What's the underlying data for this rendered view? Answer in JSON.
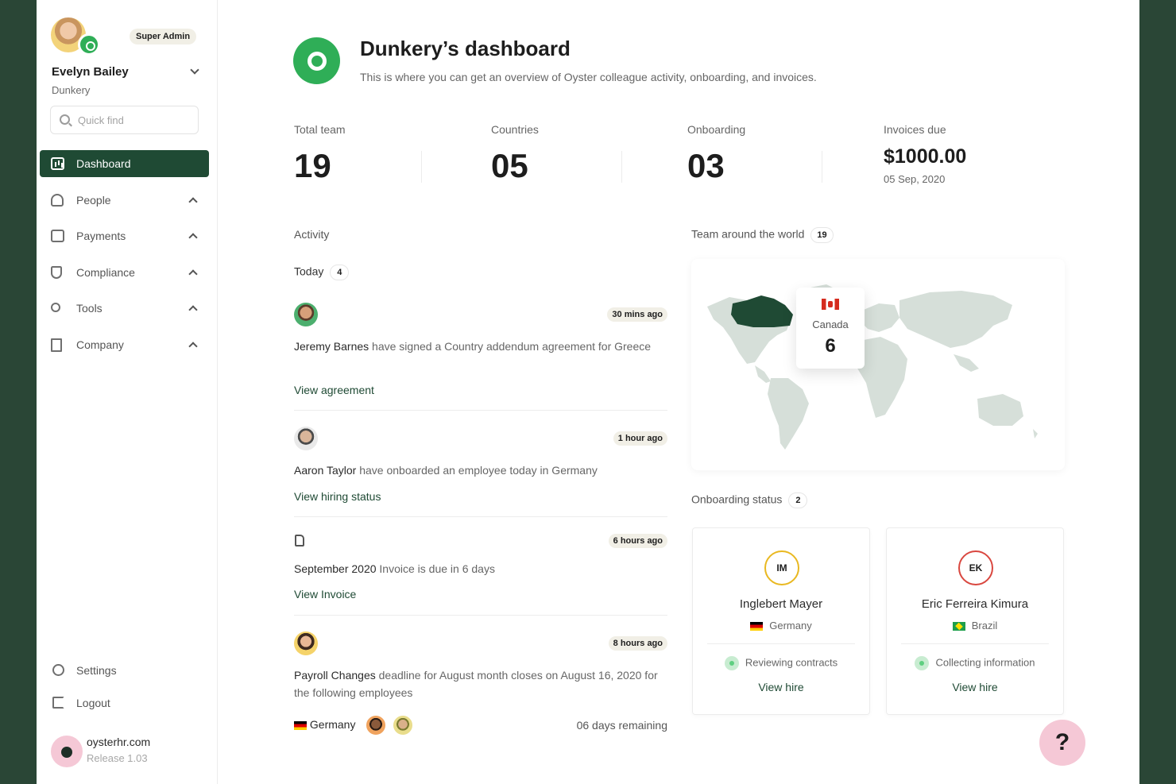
{
  "sidebar": {
    "user": {
      "name": "Evelyn Bailey",
      "company": "Dunkery",
      "role": "Super Admin"
    },
    "search": {
      "placeholder": "Quick find"
    },
    "nav": [
      {
        "label": "Dashboard",
        "icon": "chart-icon",
        "active": true
      },
      {
        "label": "People",
        "icon": "people-icon"
      },
      {
        "label": "Payments",
        "icon": "wallet-icon"
      },
      {
        "label": "Compliance",
        "icon": "shield-icon"
      },
      {
        "label": "Tools",
        "icon": "wrench-icon"
      },
      {
        "label": "Company",
        "icon": "building-icon"
      }
    ],
    "bottom": {
      "settings": "Settings",
      "logout": "Logout"
    },
    "brand": {
      "url": "oysterhr.com",
      "release": "Release 1.03"
    }
  },
  "header": {
    "title": "Dunkery’s dashboard",
    "subtitle": "This is where you can get an overview of Oyster colleague activity, onboarding, and invoices."
  },
  "stats": {
    "total_team": {
      "label": "Total team",
      "value": "19"
    },
    "countries": {
      "label": "Countries",
      "value": "05"
    },
    "onboarding": {
      "label": "Onboarding",
      "value": "03"
    },
    "invoices": {
      "label": "Invoices due",
      "value": "$1000.00",
      "date": "05 Sep, 2020"
    }
  },
  "activity": {
    "title": "Activity",
    "today_label": "Today",
    "today_count": "4",
    "items": [
      {
        "time": "30 mins ago",
        "actor": "Jeremy Barnes",
        "text": " have signed a Country addendum agreement for Greece",
        "link": "View agreement"
      },
      {
        "time": "1 hour ago",
        "actor": "Aaron Taylor",
        "text": " have onboarded an employee today in Germany",
        "link": "View hiring status"
      },
      {
        "time": "6 hours ago",
        "actor": "September 2020",
        "text": " Invoice is due in 6 days",
        "link": "View Invoice"
      },
      {
        "time": "8 hours ago",
        "actor": "Payroll Changes",
        "text": " deadline for August month closes on August 16, 2020 for the following employees",
        "country": "Germany",
        "remaining": "06 days remaining"
      }
    ]
  },
  "team_map": {
    "title": "Team around the world",
    "count": "19",
    "tooltip": {
      "country": "Canada",
      "count": "6"
    },
    "highlight_color": "#1f4a34",
    "land_color": "#d6dfd9"
  },
  "onboarding": {
    "title": "Onboarding status",
    "count": "2",
    "cards": [
      {
        "initials": "IM",
        "name": "Inglebert Mayer",
        "country": "Germany",
        "status": "Reviewing contracts",
        "link": "View hire"
      },
      {
        "initials": "EK",
        "name": "Eric Ferreira Kimura",
        "country": "Brazil",
        "status": "Collecting information",
        "link": "View hire"
      }
    ]
  },
  "help": {
    "label": "?"
  },
  "colors": {
    "brand_green": "#2fae57",
    "dark_green": "#1f4a34",
    "frame": "#2a4636",
    "pink": "#f5c8d6"
  }
}
